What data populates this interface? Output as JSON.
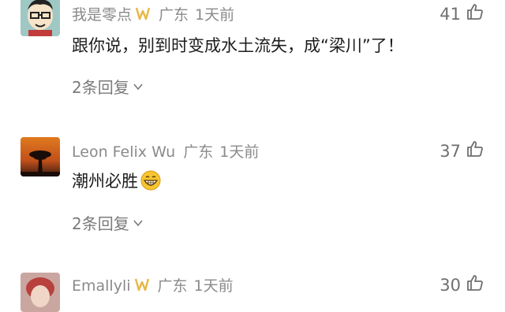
{
  "comments": [
    {
      "name": "我是零点",
      "location": "广东",
      "time": "1天前",
      "likes": "41",
      "text": "跟你说，别到时变成水土流失，成“梁川”了！",
      "replies": "2条回复"
    },
    {
      "name": "Leon Felix Wu",
      "location": "广东",
      "time": "1天前",
      "likes": "37",
      "text": "潮州必胜",
      "replies": "2条回复"
    },
    {
      "name": "Emallyli",
      "location": "广东",
      "time": "1天前",
      "likes": "30"
    }
  ],
  "icons": {
    "like": "thumbs-up-icon",
    "badge": "gold-badge-icon",
    "expand": "chevron-down-icon",
    "emoji": "grin-emoji-icon"
  },
  "colors": {
    "meta": "#8a8a8a",
    "text": "#1c1c1c",
    "badge": "#e8b84a"
  }
}
